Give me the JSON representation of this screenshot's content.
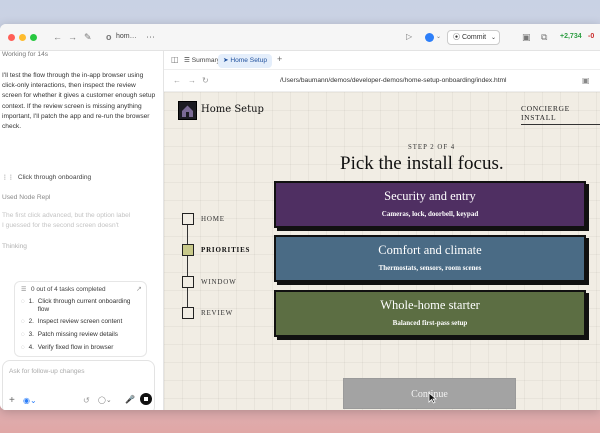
{
  "titlebar": {
    "project_label": "hom…",
    "commit_label": "Commit",
    "diff_added": "+2,734",
    "diff_removed": "-0"
  },
  "left_panel": {
    "status": "Working for 14s",
    "message": "I'll test the flow through the in-app browser using click-only interactions, then inspect the review screen for whether it gives a customer enough setup context. If the review screen is missing anything important, I'll patch the app and re-run the browser check.",
    "action_label": "Click through onboarding",
    "tool_label": "Used Node Repl",
    "faded_text": "The first click advanced, but the option label I guessed for the second screen doesn't",
    "thinking_label": "Thinking",
    "tasks_header": "0 out of 4 tasks completed",
    "tasks": [
      {
        "num": "1.",
        "text": "Click through current onboarding flow"
      },
      {
        "num": "2.",
        "text": "Inspect review screen content"
      },
      {
        "num": "3.",
        "text": "Patch missing review details"
      },
      {
        "num": "4.",
        "text": "Verify fixed flow in browser"
      }
    ],
    "composer_placeholder": "Ask for follow-up changes"
  },
  "right_panel": {
    "tabs": [
      {
        "label": "Summary"
      },
      {
        "label": "Home Setup"
      }
    ],
    "url": "/Users/baumann/demos/developer-demos/home-setup-onboarding/index.html"
  },
  "app": {
    "brand_title": "Home Setup",
    "concierge_label": "CONCIERGE INSTALL",
    "step_label": "STEP 2 OF 4",
    "heading": "Pick the install focus.",
    "steps": [
      {
        "label": "HOME"
      },
      {
        "label": "PRIORITIES"
      },
      {
        "label": "WINDOW"
      },
      {
        "label": "REVIEW"
      }
    ],
    "active_step": "PRIORITIES",
    "options": [
      {
        "title": "Security and entry",
        "subtitle": "Cameras, lock, doorbell, keypad",
        "color": "#4f2f62"
      },
      {
        "title": "Comfort and climate",
        "subtitle": "Thermostats, sensors, room scenes",
        "color": "#4a6b85"
      },
      {
        "title": "Whole-home starter",
        "subtitle": "Balanced first-pass setup",
        "color": "#5c6e43"
      }
    ],
    "continue_label": "Continue"
  },
  "colors": {
    "app_background": "#f1ede4",
    "active_step_fill": "#c8c98a",
    "tab_active_bg": "#e4eefb",
    "continue_bg": "#a3a3a3",
    "diff_added": "#2f9e44",
    "diff_removed": "#c92a2a"
  }
}
